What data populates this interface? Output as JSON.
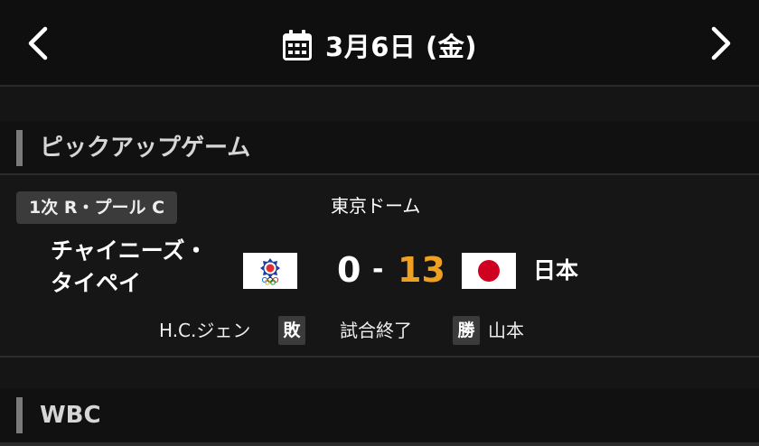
{
  "header": {
    "date": "3月6日 (金)",
    "prev_icon": "chevron-left-icon",
    "next_icon": "chevron-right-icon",
    "calendar_icon": "calendar-icon"
  },
  "sections": {
    "pickup_title": "ピックアップゲーム",
    "wbc_title": "WBC"
  },
  "game": {
    "round": "1次 R・プール C",
    "venue": "東京ドーム",
    "away_team": "チャイニーズ・タイペイ",
    "away_team_line1": "チャイニーズ・",
    "away_team_line2": "タイペイ",
    "away_score": "0",
    "separator": "-",
    "home_score": "13",
    "home_team": "日本",
    "losing_pitcher": "H.C.ジェン",
    "losing_label": "敗",
    "status": "試合終了",
    "winning_label": "勝",
    "winning_pitcher": "山本"
  },
  "colors": {
    "background": "#111111",
    "winner_score": "#f0a020",
    "badge_bg": "#3b3b3b",
    "section_bar": "#7a7a7a"
  }
}
